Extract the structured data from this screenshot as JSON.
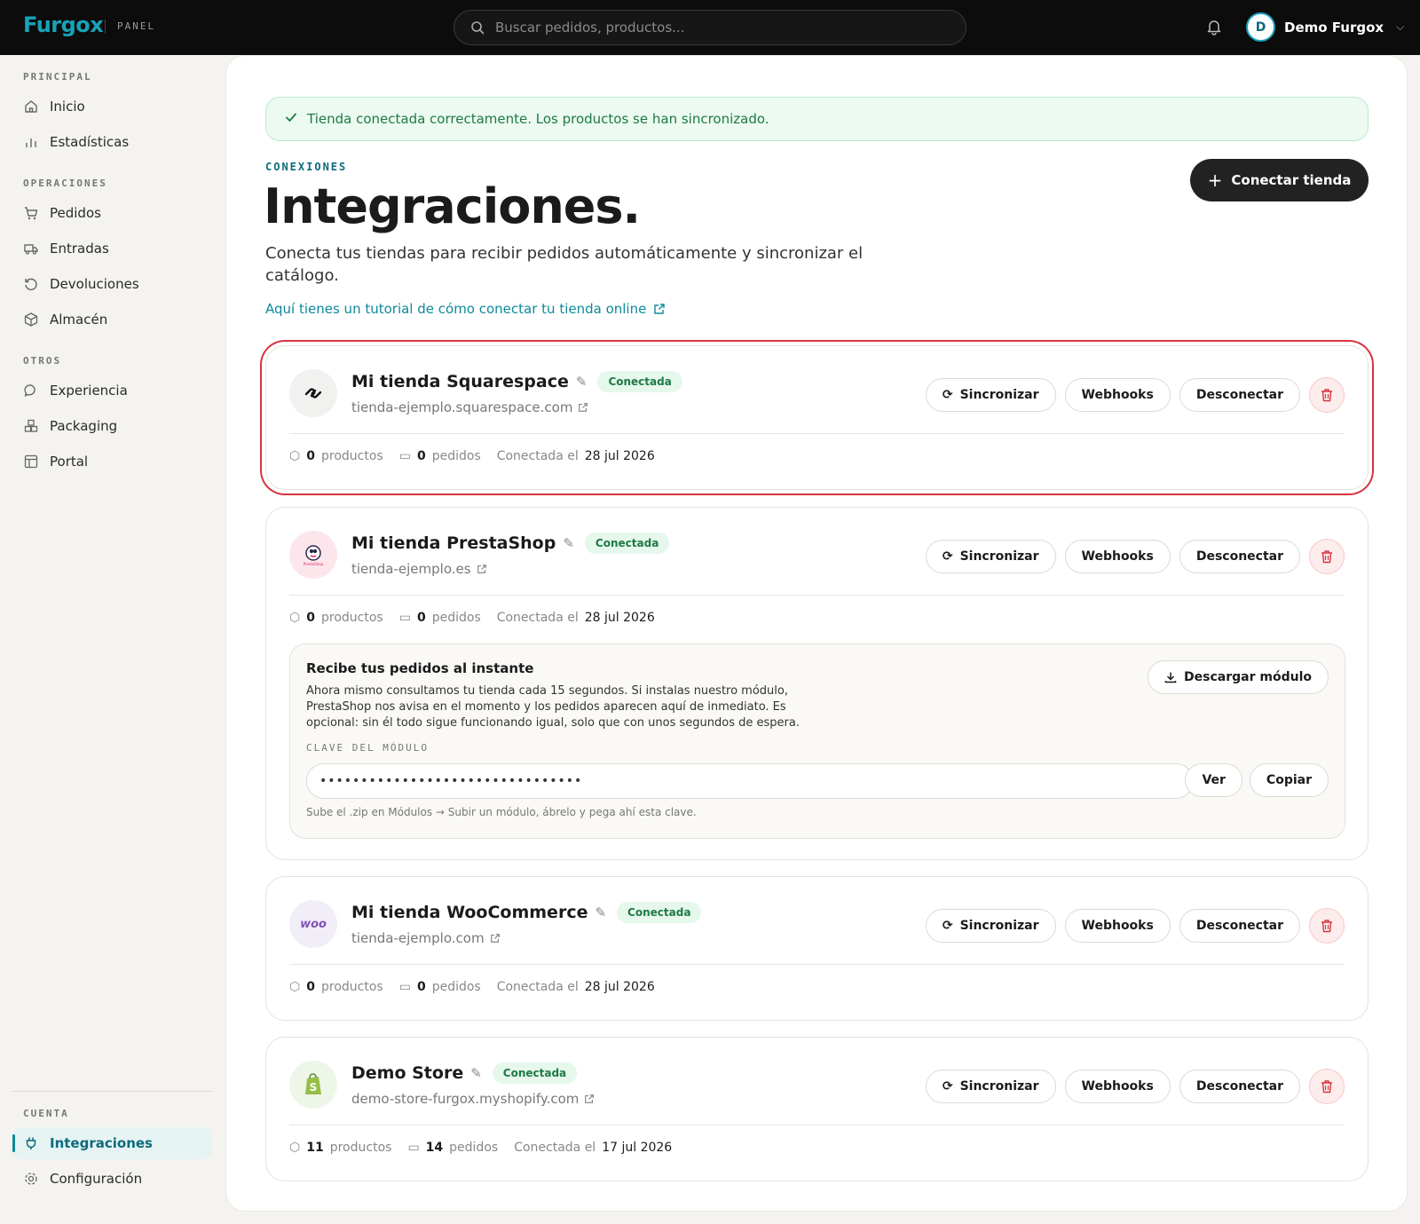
{
  "topbar": {
    "brand": "Furgox",
    "brand_sub": "PANEL",
    "search_placeholder": "Buscar pedidos, productos...",
    "user_initial": "D",
    "user_name": "Demo Furgox"
  },
  "sidebar": {
    "sections": {
      "principal": "PRINCIPAL",
      "operaciones": "OPERACIONES",
      "otros": "OTROS",
      "cuenta": "CUENTA"
    },
    "items": {
      "inicio": "Inicio",
      "estadisticas": "Estadísticas",
      "pedidos": "Pedidos",
      "entradas": "Entradas",
      "devoluciones": "Devoluciones",
      "almacen": "Almacén",
      "experiencia": "Experiencia",
      "packaging": "Packaging",
      "portal": "Portal",
      "integraciones": "Integraciones",
      "configuracion": "Configuración"
    }
  },
  "main": {
    "alert": "Tienda conectada correctamente. Los productos se han sincronizado.",
    "eyebrow": "CONEXIONES",
    "title": "Integraciones.",
    "description": "Conecta tus tiendas para recibir pedidos automáticamente y sincronizar el catálogo.",
    "tutorial_link": "Aquí tienes un tutorial de cómo conectar tu tienda online",
    "connect_button": "Conectar tienda"
  },
  "labels": {
    "badge": "Conectada",
    "sync": "Sincronizar",
    "webhooks": "Webhooks",
    "disconnect": "Desconectar",
    "productos": "productos",
    "pedidos": "pedidos",
    "conectada_el": "Conectada el"
  },
  "stores": [
    {
      "name": "Mi tienda Squarespace",
      "url": "tienda-ejemplo.squarespace.com",
      "products": "0",
      "orders": "0",
      "date": "28 jul 2026",
      "logo": "squarespace-logo"
    },
    {
      "name": "Mi tienda PrestaShop",
      "url": "tienda-ejemplo.es",
      "products": "0",
      "orders": "0",
      "date": "28 jul 2026",
      "logo": "prestashop-logo",
      "logo_text": "PrestaShop"
    },
    {
      "name": "Mi tienda WooCommerce",
      "url": "tienda-ejemplo.com",
      "products": "0",
      "orders": "0",
      "date": "28 jul 2026",
      "logo": "woocommerce-logo",
      "logo_text": "woo"
    },
    {
      "name": "Demo Store",
      "url": "demo-store-furgox.myshopify.com",
      "products": "11",
      "orders": "14",
      "date": "17 jul 2026",
      "logo": "shopify-logo"
    }
  ],
  "module": {
    "title": "Recibe tus pedidos al instante",
    "description": "Ahora mismo consultamos tu tienda cada 15 segundos. Si instalas nuestro módulo, PrestaShop nos avisa en el momento y los pedidos aparecen aquí de inmediato. Es opcional: sin él todo sigue funcionando igual, solo que con unos segundos de espera.",
    "download": "Descargar módulo",
    "key_label": "CLAVE DEL MÓDULO",
    "key_value": "••••••••••••••••••••••••••••••••",
    "view": "Ver",
    "copy": "Copiar",
    "hint": "Sube el .zip en Módulos → Subir un módulo, ábrelo y pega ahí esta clave."
  },
  "colors": {
    "accent": "#0d8a9b",
    "success_bg": "#ecfaf1",
    "danger": "#d8333f"
  }
}
